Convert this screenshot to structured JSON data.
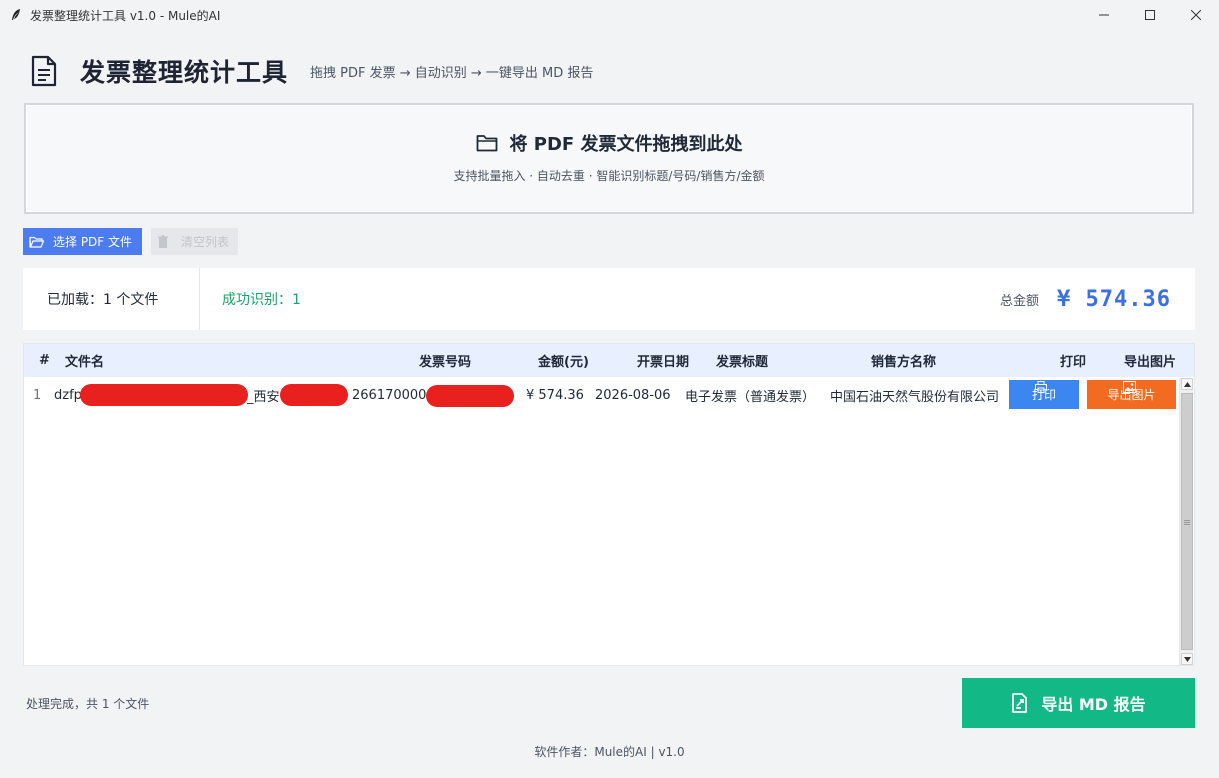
{
  "window": {
    "title": "发票整理统计工具 v1.0  -  Mule的AI"
  },
  "header": {
    "title": "发票整理统计工具",
    "subtitle": "拖拽 PDF 发票 → 自动识别 → 一键导出 MD 报告"
  },
  "dropzone": {
    "title": "将 PDF 发票文件拖拽到此处",
    "subtitle": "支持批量拖入 · 自动去重 · 智能识别标题/号码/销售方/金额"
  },
  "toolbar": {
    "select_label": "选择 PDF 文件",
    "clear_label": "清空列表"
  },
  "stats": {
    "loaded": "已加载：1 个文件",
    "success": "成功识别：1",
    "total_label": "总金额",
    "total_value": "¥ 574.36"
  },
  "table": {
    "headers": {
      "idx": "#",
      "filename": "文件名",
      "number": "发票号码",
      "amount": "金额(元)",
      "date": "开票日期",
      "invoice_title": "发票标题",
      "seller": "销售方名称",
      "print": "打印",
      "export": "导出图片"
    },
    "rows": [
      {
        "idx": "1",
        "filename_prefix": "dzfp",
        "filename_mid": "_西安",
        "number_prefix": "266170000",
        "amount": "¥ 574.36",
        "date": "2026-08-06",
        "invoice_title": "电子发票（普通发票）",
        "seller": "中国石油天然气股份有限公司",
        "print_label": "打印",
        "export_label": "导出图片"
      }
    ]
  },
  "status": "处理完成，共 1 个文件",
  "export_md_label": "导出 MD 报告",
  "footer": "软件作者：Mule的AI  |  v1.0",
  "colors": {
    "primary": "#4c7cf0",
    "success": "#12b886",
    "orange": "#f26b20",
    "total": "#3b6fe8",
    "redaction": "#e8211f"
  }
}
